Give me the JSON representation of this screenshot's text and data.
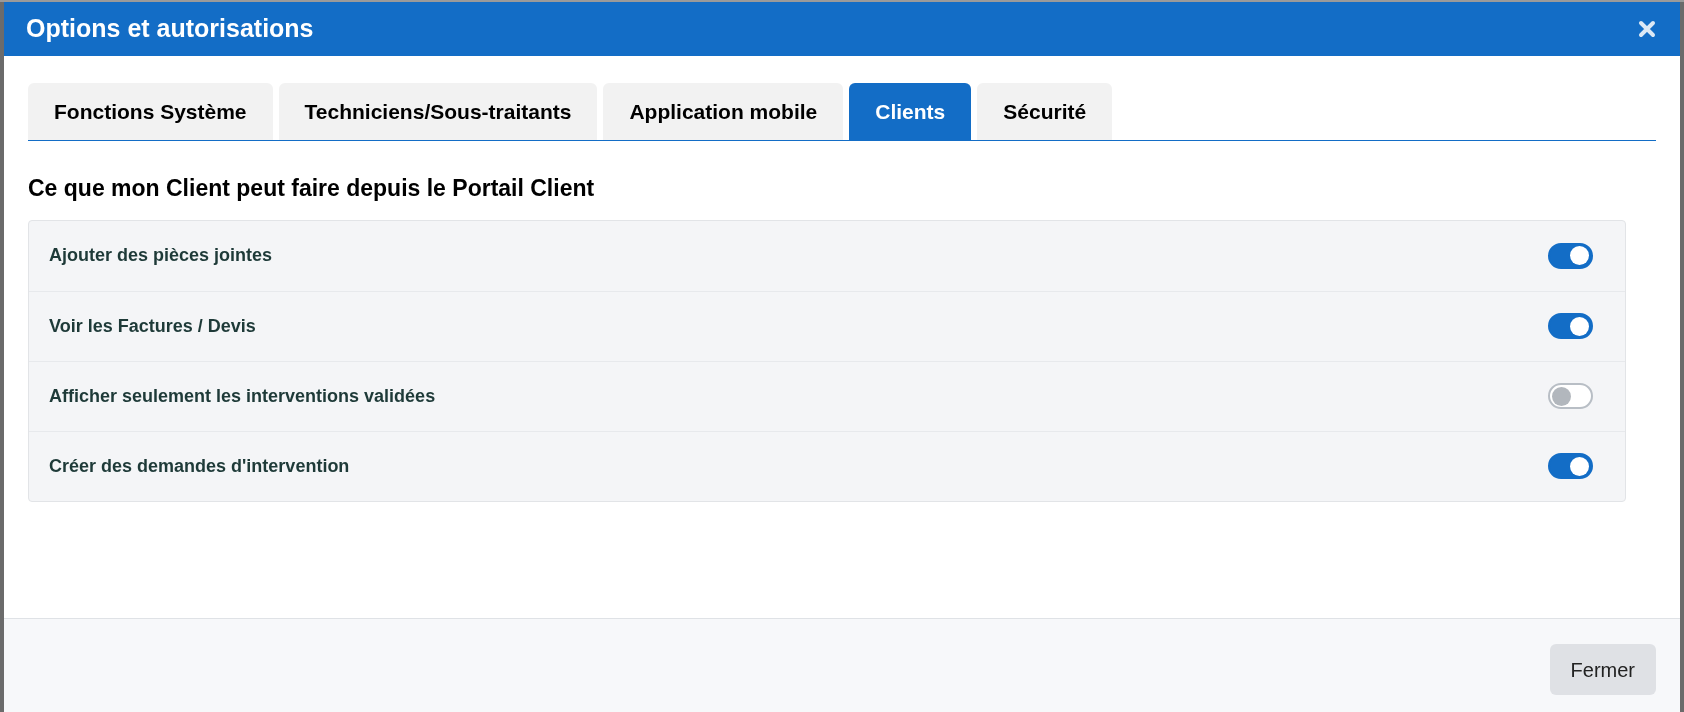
{
  "dialog": {
    "title": "Options et autorisations"
  },
  "tabs": [
    {
      "label": "Fonctions Système",
      "selected": false
    },
    {
      "label": "Techniciens/Sous-traitants",
      "selected": false
    },
    {
      "label": "Application mobile",
      "selected": false
    },
    {
      "label": "Clients",
      "selected": true
    },
    {
      "label": "Sécurité",
      "selected": false
    }
  ],
  "section": {
    "heading": "Ce que mon Client peut faire depuis le Portail Client"
  },
  "settings": [
    {
      "label": "Ajouter des pièces jointes",
      "on": true
    },
    {
      "label": "Voir les Factures / Devis",
      "on": true
    },
    {
      "label": "Afficher seulement les interventions validées",
      "on": false
    },
    {
      "label": "Créer des demandes d'intervention",
      "on": true
    }
  ],
  "footer": {
    "button": "Fermer"
  }
}
